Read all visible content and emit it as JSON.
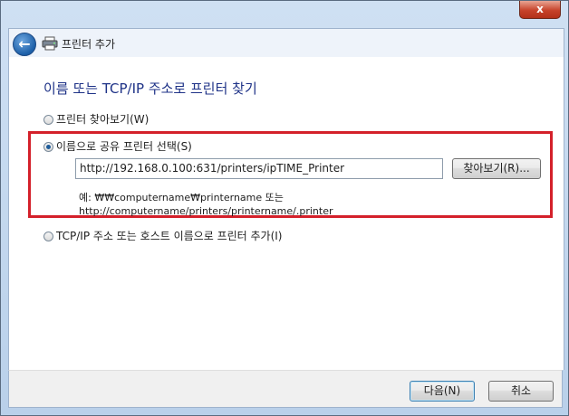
{
  "window": {
    "close_glyph": "x"
  },
  "nav": {
    "title": "프린터 추가",
    "back_icon": "back-arrow-icon",
    "app_icon": "printer-icon"
  },
  "main": {
    "heading": "이름 또는 TCP/IP 주소로 프린터 찾기",
    "options": [
      {
        "label": "프린터 찾아보기(W)",
        "checked": false
      },
      {
        "label": "이름으로 공유 프린터 선택(S)",
        "checked": true
      },
      {
        "label": "TCP/IP 주소 또는 호스트 이름으로 프린터 추가(I)",
        "checked": false
      }
    ],
    "share_input_value": "http://192.168.0.100:631/printers/ipTIME_Printer",
    "browse_label": "찾아보기(R)...",
    "example_line1": "예: ₩₩computername₩printername 또는",
    "example_line2": "http://computername/printers/printername/.printer",
    "highlight_color": "#d4202a"
  },
  "footer": {
    "next_label": "다음(N)",
    "cancel_label": "취소"
  }
}
